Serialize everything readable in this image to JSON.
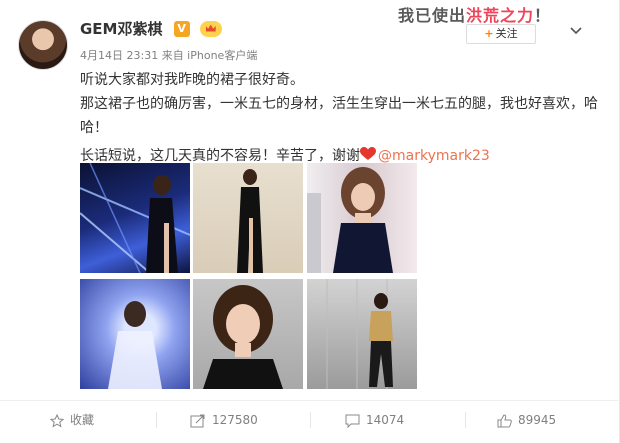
{
  "stamp": {
    "prefix": "我已使出",
    "highlight": "洪荒之力",
    "suffix": "！"
  },
  "user": {
    "name": "GEM邓紫棋",
    "verified_badge": "V"
  },
  "post": {
    "meta": "4月14日 23:31 来自 iPhone客户端",
    "line1": "听说大家都对我昨晚的裙子很好奇。",
    "line2": "那这裙子也的确厉害，一米五七的身材，活生生穿出一米七五的腿，我也好喜欢，哈哈！",
    "line3": "长话短说，这几天真的不容易！辛苦了，谢谢",
    "mention": "@markymark23"
  },
  "follow_button": {
    "plus": "+",
    "label": "关注"
  },
  "actions": {
    "favorite": "收藏",
    "repost": "127580",
    "comment": "14074",
    "like": "89945"
  },
  "colors": {
    "accent": "#ff8200",
    "mention": "#eb7350",
    "heart": "#e6372f"
  }
}
